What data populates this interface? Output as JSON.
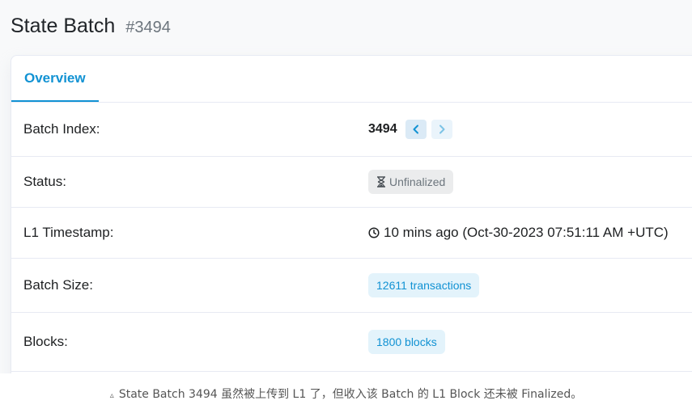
{
  "header": {
    "title": "State Batch",
    "batch_ref": "#3494"
  },
  "tabs": [
    {
      "label": "Overview",
      "active": true
    }
  ],
  "rows": {
    "batch_index": {
      "label": "Batch Index:",
      "value": "3494"
    },
    "status": {
      "label": "Status:",
      "value": "Unfinalized"
    },
    "l1_timestamp": {
      "label": "L1 Timestamp:",
      "value": "10 mins ago (Oct-30-2023 07:51:11 AM +UTC)"
    },
    "batch_size": {
      "label": "Batch Size:",
      "value": "12611 transactions"
    },
    "blocks": {
      "label": "Blocks:",
      "value": "1800 blocks"
    }
  },
  "caption": {
    "mark": "▵",
    "text": "State Batch 3494 虽然被上传到 L1 了，但收入该 Batch 的 L1 Block 还未被 Finalized。"
  },
  "icons": {
    "prev": "chevron-left-icon",
    "next": "chevron-right-icon",
    "status": "hourglass-icon",
    "timestamp": "clock-icon"
  },
  "colors": {
    "accent": "#1192d3",
    "badge_blue_bg": "#e3f3fb",
    "badge_grey_bg": "#ebeced",
    "text": "#1e2022",
    "muted": "#6c757d"
  }
}
